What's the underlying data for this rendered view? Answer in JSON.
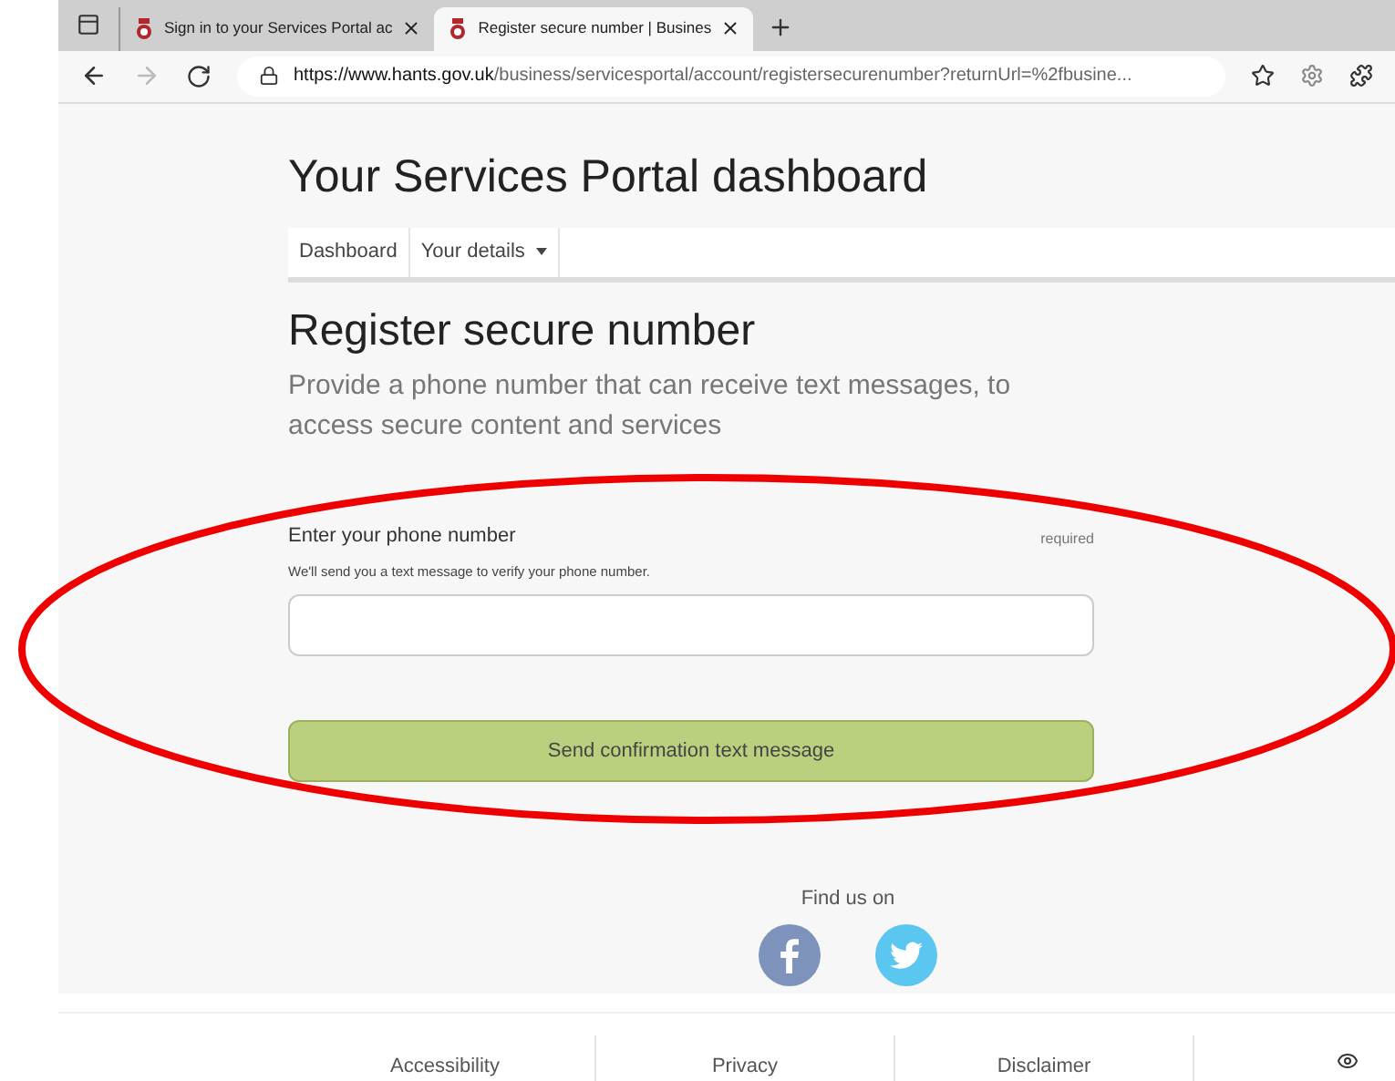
{
  "browser": {
    "tabs": [
      {
        "title": "Sign in to your Services Portal ac",
        "selected": false
      },
      {
        "title": "Register secure number | Busines",
        "selected": true
      }
    ],
    "url_host": "https://www.hants.gov.uk",
    "url_path": "/business/servicesportal/account/registersecurenumber?returnUrl=%2fbusine..."
  },
  "page": {
    "heading": "Your Services Portal dashboard",
    "nav": [
      {
        "label": "Dashboard",
        "dropdown": false
      },
      {
        "label": "Your details",
        "dropdown": true
      }
    ],
    "title": "Register secure number",
    "subtitle": "Provide a phone number that can receive text messages, to access secure content and services",
    "field": {
      "label": "Enter your phone number",
      "required": "required",
      "hint": "We'll send you a text message to verify your phone number."
    },
    "submit": "Send confirmation text message",
    "social_heading": "Find us on"
  },
  "footer": {
    "links": [
      "Accessibility",
      "Privacy",
      "Disclaimer"
    ]
  }
}
